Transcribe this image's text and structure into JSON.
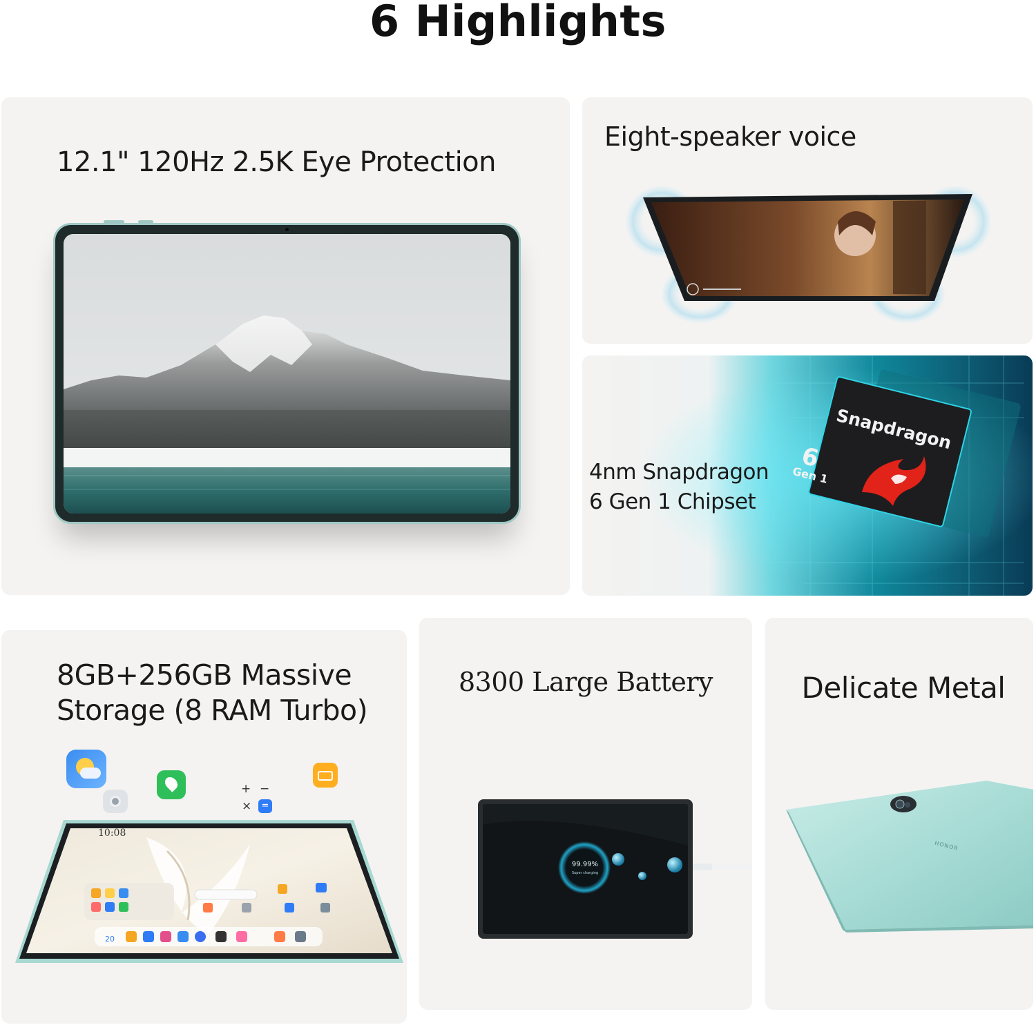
{
  "page": {
    "title": "6 Highlights"
  },
  "cards": {
    "display": {
      "title": "12.1\" 120Hz 2.5K Eye Protection"
    },
    "speaker": {
      "title": "Eight-speaker voice"
    },
    "chip": {
      "title_line1": "4nm Snapdragon",
      "title_line2": "6 Gen 1 Chipset",
      "chip_brand": "Snapdragon",
      "chip_number": "6",
      "chip_gen": "Gen 1"
    },
    "storage": {
      "title_line1": "8GB+256GB Massive",
      "title_line2": "Storage (8 RAM Turbo)",
      "screen_time": "10:08",
      "dock_date": "20"
    },
    "battery": {
      "title": "8300 Large Battery",
      "charge_percent": "99.99%",
      "charge_label": "Super charging"
    },
    "metal": {
      "title": "Delicate Metal",
      "brand_mark": "HONOR"
    }
  },
  "colors": {
    "card_bg": "#f4f3f1",
    "tablet_mint": "#a9dcd6",
    "chip_cyan": "#1fd4e0",
    "snapdragon_red": "#e2231a"
  }
}
